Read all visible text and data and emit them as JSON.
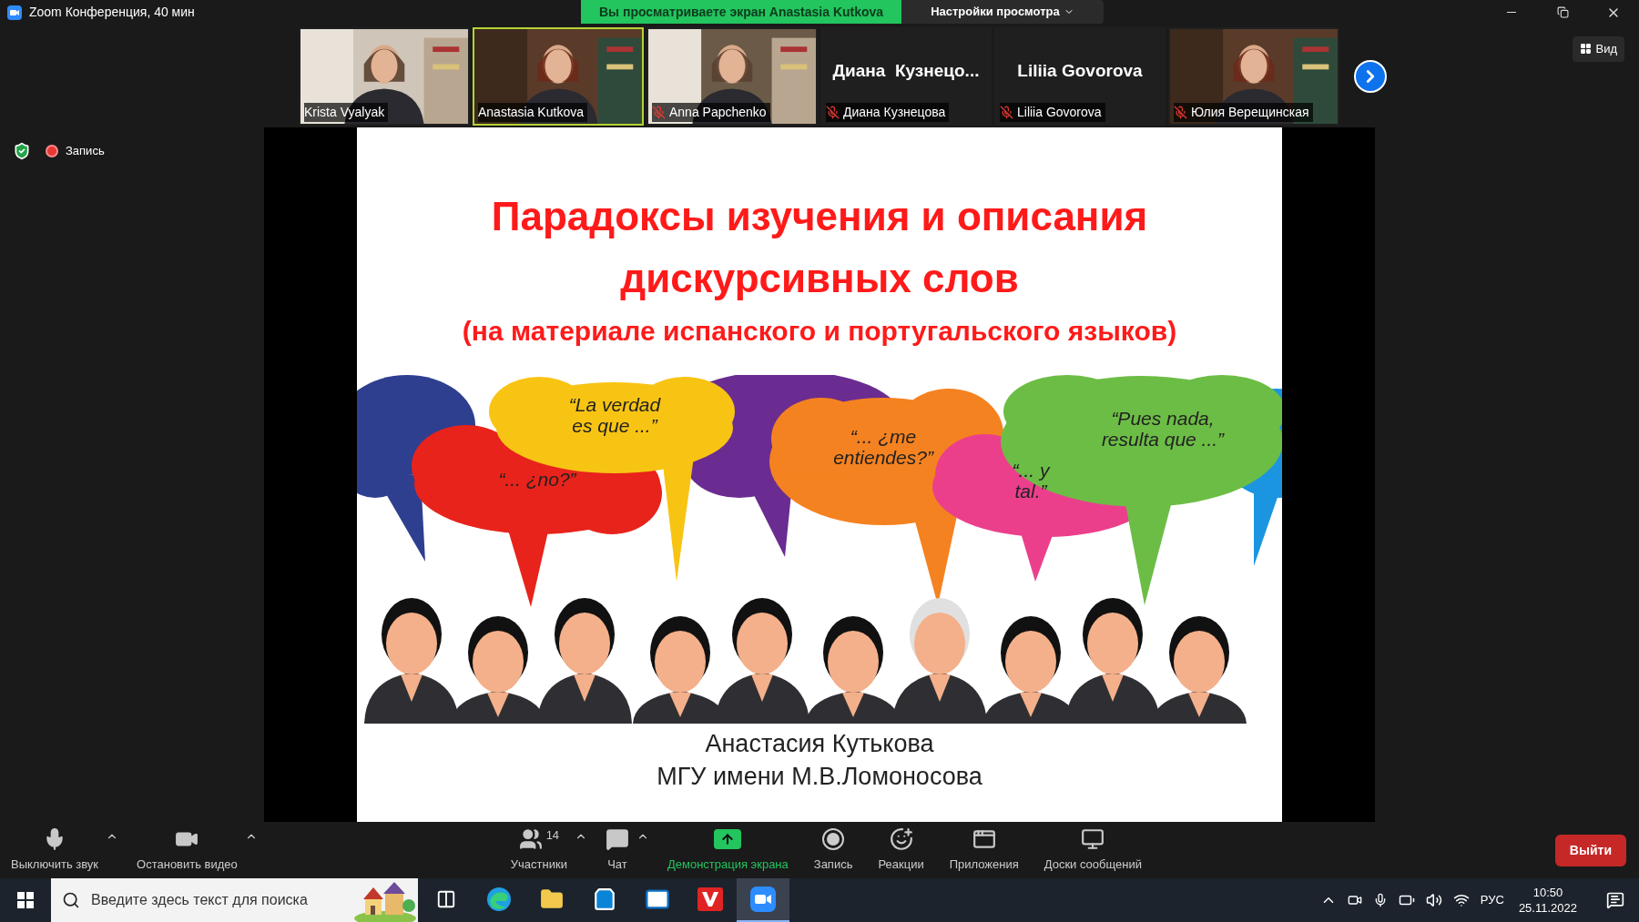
{
  "window": {
    "title": "Zoom Конференция, 40 мин"
  },
  "share_banner": {
    "text": "Вы просматриваете экран Anastasia Kutkova",
    "view_settings": "Настройки просмотра"
  },
  "participants": [
    {
      "name": "Krista Vyalyak",
      "video": true,
      "muted": false,
      "speaking": false
    },
    {
      "name": "Anastasia Kutkova",
      "video": true,
      "muted": false,
      "speaking": true
    },
    {
      "name": "Anna Papchenko",
      "video": true,
      "muted": true,
      "speaking": false
    },
    {
      "name": "Диана Кузнецова",
      "display_name": "Диана  Кузнецо...",
      "video": false,
      "muted": true,
      "speaking": false
    },
    {
      "name": "Liliia Govorova",
      "display_name": "Liliia Govorova",
      "video": false,
      "muted": true,
      "speaking": false
    },
    {
      "name": "Юлия Верещинская",
      "video": true,
      "muted": true,
      "speaking": false
    }
  ],
  "view_button": "Вид",
  "recording": {
    "label": "Запись"
  },
  "slide": {
    "title_lines": [
      "Парадоксы изучения и описания",
      "дискурсивных слов"
    ],
    "subtitle": "(на материале испанского и португальского языков)",
    "bubbles": [
      {
        "color": "#2e3f8f"
      },
      {
        "color": "#6a2c91"
      },
      {
        "color": "#1b95e0"
      },
      {
        "color": "#e8231b",
        "lines": [
          "“... ¿no?”"
        ]
      },
      {
        "color": "#f8c413",
        "lines": [
          "“La verdad",
          "es que ...”"
        ]
      },
      {
        "color": "#f58220",
        "lines": [
          "“... ¿me",
          "entiendes?”"
        ]
      },
      {
        "color": "#eb3f8c",
        "lines": [
          "“... y",
          "tal.”"
        ]
      },
      {
        "color": "#6cbd45",
        "lines": [
          "“Pues nada,",
          "resulta que ...”"
        ]
      }
    ],
    "author": "Анастасия Кутькова",
    "affiliation": "МГУ имени М.В.Ломоносова"
  },
  "toolbar": {
    "left": [
      {
        "kind": "mic",
        "label": "Выключить звук"
      },
      {
        "kind": "video",
        "label": "Остановить видео"
      }
    ],
    "center": [
      {
        "kind": "participants",
        "label": "Участники",
        "count": "14"
      },
      {
        "kind": "chat",
        "label": "Чат"
      },
      {
        "kind": "share",
        "label": "Демонстрация экрана"
      },
      {
        "kind": "record",
        "label": "Запись"
      },
      {
        "kind": "reactions",
        "label": "Реакции"
      },
      {
        "kind": "apps",
        "label": "Приложения"
      },
      {
        "kind": "boards",
        "label": "Доски сообщений"
      }
    ],
    "leave": "Выйти"
  },
  "taskbar": {
    "search_placeholder": "Введите здесь текст для поиска",
    "apps": [
      {
        "kind": "taskview",
        "selected": false
      },
      {
        "kind": "edge",
        "selected": false
      },
      {
        "kind": "explorer",
        "selected": false
      },
      {
        "kind": "store",
        "selected": false
      },
      {
        "kind": "mail",
        "selected": false
      },
      {
        "kind": "vivaldi",
        "selected": false
      },
      {
        "kind": "zoom",
        "selected": true
      }
    ],
    "language": "РУС",
    "time": "10:50",
    "date": "25.11.2022"
  }
}
